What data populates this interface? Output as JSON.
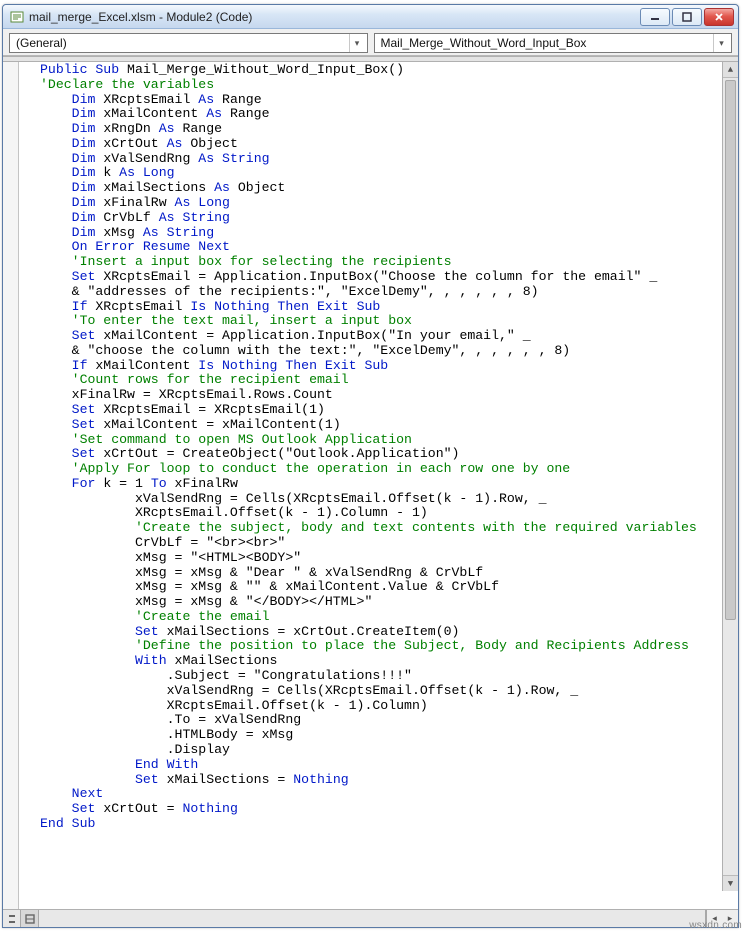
{
  "titlebar": {
    "title": "mail_merge_Excel.xlsm - Module2 (Code)",
    "min_icon": "–",
    "max_icon": "▭",
    "close_icon": "X"
  },
  "dropdowns": {
    "left": "(General)",
    "right": "Mail_Merge_Without_Word_Input_Box"
  },
  "code_tokens": [
    [
      [
        "kw",
        "Public Sub"
      ],
      [
        "",
        " Mail_Merge_Without_Word_Input_Box()"
      ]
    ],
    [
      [
        "cm",
        "'Declare the variables"
      ]
    ],
    [
      [
        "",
        "    "
      ],
      [
        "kw",
        "Dim"
      ],
      [
        "",
        " XRcptsEmail "
      ],
      [
        "kw",
        "As"
      ],
      [
        "",
        " Range"
      ]
    ],
    [
      [
        "",
        "    "
      ],
      [
        "kw",
        "Dim"
      ],
      [
        "",
        " xMailContent "
      ],
      [
        "kw",
        "As"
      ],
      [
        "",
        " Range"
      ]
    ],
    [
      [
        "",
        "    "
      ],
      [
        "kw",
        "Dim"
      ],
      [
        "",
        " xRngDn "
      ],
      [
        "kw",
        "As"
      ],
      [
        "",
        " Range"
      ]
    ],
    [
      [
        "",
        "    "
      ],
      [
        "kw",
        "Dim"
      ],
      [
        "",
        " xCrtOut "
      ],
      [
        "kw",
        "As"
      ],
      [
        "",
        " Object"
      ]
    ],
    [
      [
        "",
        "    "
      ],
      [
        "kw",
        "Dim"
      ],
      [
        "",
        " xValSendRng "
      ],
      [
        "kw",
        "As String"
      ]
    ],
    [
      [
        "",
        "    "
      ],
      [
        "kw",
        "Dim"
      ],
      [
        "",
        " k "
      ],
      [
        "kw",
        "As Long"
      ]
    ],
    [
      [
        "",
        "    "
      ],
      [
        "kw",
        "Dim"
      ],
      [
        "",
        " xMailSections "
      ],
      [
        "kw",
        "As"
      ],
      [
        "",
        " Object"
      ]
    ],
    [
      [
        "",
        "    "
      ],
      [
        "kw",
        "Dim"
      ],
      [
        "",
        " xFinalRw "
      ],
      [
        "kw",
        "As Long"
      ]
    ],
    [
      [
        "",
        "    "
      ],
      [
        "kw",
        "Dim"
      ],
      [
        "",
        " CrVbLf "
      ],
      [
        "kw",
        "As String"
      ]
    ],
    [
      [
        "",
        "    "
      ],
      [
        "kw",
        "Dim"
      ],
      [
        "",
        " xMsg "
      ],
      [
        "kw",
        "As String"
      ]
    ],
    [
      [
        "",
        "    "
      ],
      [
        "kw",
        "On Error Resume Next"
      ]
    ],
    [
      [
        "",
        "    "
      ],
      [
        "cm",
        "'Insert a input box for selecting the recipients"
      ]
    ],
    [
      [
        "",
        "    "
      ],
      [
        "kw",
        "Set"
      ],
      [
        "",
        " XRcptsEmail = Application.InputBox(\"Choose the column for the email\" _"
      ]
    ],
    [
      [
        "",
        "    & \"addresses of the recipients:\", \"ExcelDemy\", , , , , , 8)"
      ]
    ],
    [
      [
        "",
        "    "
      ],
      [
        "kw",
        "If"
      ],
      [
        "",
        " XRcptsEmail "
      ],
      [
        "kw",
        "Is Nothing Then Exit Sub"
      ]
    ],
    [
      [
        "",
        "    "
      ],
      [
        "cm",
        "'To enter the text mail, insert a input box"
      ]
    ],
    [
      [
        "",
        "    "
      ],
      [
        "kw",
        "Set"
      ],
      [
        "",
        " xMailContent = Application.InputBox(\"In your email,\" _"
      ]
    ],
    [
      [
        "",
        "    & \"choose the column with the text:\", \"ExcelDemy\", , , , , , 8)"
      ]
    ],
    [
      [
        "",
        "    "
      ],
      [
        "kw",
        "If"
      ],
      [
        "",
        " xMailContent "
      ],
      [
        "kw",
        "Is Nothing Then Exit Sub"
      ]
    ],
    [
      [
        "",
        "    "
      ],
      [
        "cm",
        "'Count rows for the recipient email"
      ]
    ],
    [
      [
        "",
        "    xFinalRw = XRcptsEmail.Rows.Count"
      ]
    ],
    [
      [
        "",
        "    "
      ],
      [
        "kw",
        "Set"
      ],
      [
        "",
        " XRcptsEmail = XRcptsEmail(1)"
      ]
    ],
    [
      [
        "",
        "    "
      ],
      [
        "kw",
        "Set"
      ],
      [
        "",
        " xMailContent = xMailContent(1)"
      ]
    ],
    [
      [
        "",
        "    "
      ],
      [
        "cm",
        "'Set command to open MS Outlook Application"
      ]
    ],
    [
      [
        "",
        "    "
      ],
      [
        "kw",
        "Set"
      ],
      [
        "",
        " xCrtOut = CreateObject(\"Outlook.Application\")"
      ]
    ],
    [
      [
        "",
        "    "
      ],
      [
        "cm",
        "'Apply For loop to conduct the operation in each row one by one"
      ]
    ],
    [
      [
        "",
        "    "
      ],
      [
        "kw",
        "For"
      ],
      [
        "",
        " k = 1 "
      ],
      [
        "kw",
        "To"
      ],
      [
        "",
        " xFinalRw"
      ]
    ],
    [
      [
        "",
        "            xValSendRng = Cells(XRcptsEmail.Offset(k - 1).Row, _"
      ]
    ],
    [
      [
        "",
        "            XRcptsEmail.Offset(k - 1).Column - 1)"
      ]
    ],
    [
      [
        "",
        "            "
      ],
      [
        "cm",
        "'Create the subject, body and text contents with the required variables"
      ]
    ],
    [
      [
        "",
        "            CrVbLf = \"<br><br>\""
      ]
    ],
    [
      [
        "",
        "            xMsg = \"<HTML><BODY>\""
      ]
    ],
    [
      [
        "",
        "            xMsg = xMsg & \"Dear \" & xValSendRng & CrVbLf"
      ]
    ],
    [
      [
        "",
        "            xMsg = xMsg & \"\" & xMailContent.Value & CrVbLf"
      ]
    ],
    [
      [
        "",
        "            xMsg = xMsg & \"</BODY></HTML>\""
      ]
    ],
    [
      [
        "",
        "            "
      ],
      [
        "cm",
        "'Create the email"
      ]
    ],
    [
      [
        "",
        "            "
      ],
      [
        "kw",
        "Set"
      ],
      [
        "",
        " xMailSections = xCrtOut.CreateItem(0)"
      ]
    ],
    [
      [
        "",
        "            "
      ],
      [
        "cm",
        "'Define the position to place the Subject, Body and Recipients Address"
      ]
    ],
    [
      [
        "",
        "            "
      ],
      [
        "kw",
        "With"
      ],
      [
        "",
        " xMailSections"
      ]
    ],
    [
      [
        "",
        "                .Subject = \"Congratulations!!!\""
      ]
    ],
    [
      [
        "",
        "                xValSendRng = Cells(XRcptsEmail.Offset(k - 1).Row, _"
      ]
    ],
    [
      [
        "",
        "                XRcptsEmail.Offset(k - 1).Column)"
      ]
    ],
    [
      [
        "",
        "                .To = xValSendRng"
      ]
    ],
    [
      [
        "",
        "                .HTMLBody = xMsg"
      ]
    ],
    [
      [
        "",
        "                .Display"
      ]
    ],
    [
      [
        "",
        "            "
      ],
      [
        "kw",
        "End With"
      ]
    ],
    [
      [
        "",
        "            "
      ],
      [
        "kw",
        "Set"
      ],
      [
        "",
        " xMailSections = "
      ],
      [
        "kw",
        "Nothing"
      ]
    ],
    [
      [
        "",
        "    "
      ],
      [
        "kw",
        "Next"
      ]
    ],
    [
      [
        "",
        "    "
      ],
      [
        "kw",
        "Set"
      ],
      [
        "",
        " xCrtOut = "
      ],
      [
        "kw",
        "Nothing"
      ]
    ],
    [
      [
        "kw",
        "End Sub"
      ]
    ]
  ],
  "watermark": "wsxdn.com"
}
